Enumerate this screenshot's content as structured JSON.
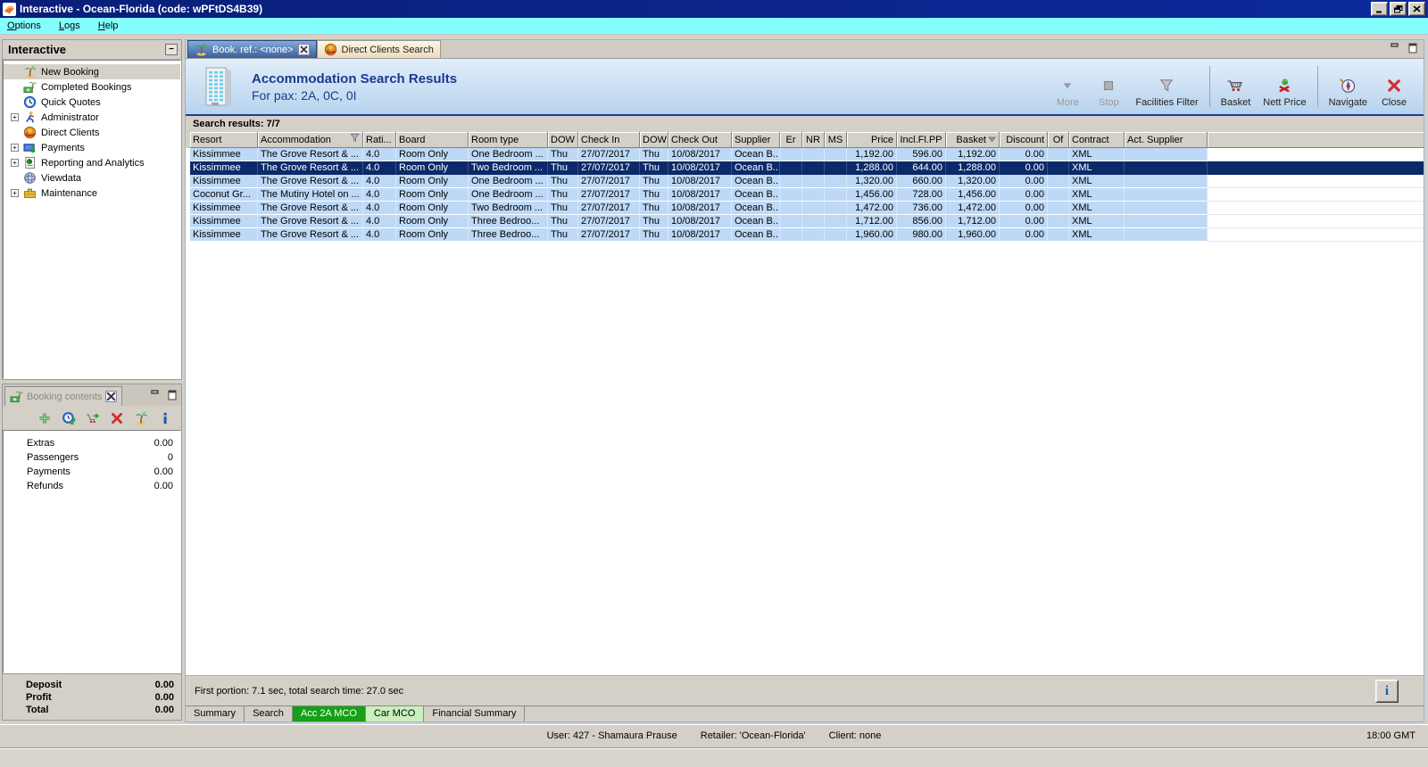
{
  "window": {
    "title": "Interactive - Ocean-Florida (code: wPFtDS4B39)",
    "clock": "18:00 GMT",
    "status": {
      "user": "User: 427 - Shamaura Prause",
      "retailer": "Retailer: 'Ocean-Florida'",
      "client": "Client: none"
    }
  },
  "menu": [
    "Options",
    "Logs",
    "Help"
  ],
  "sidebar": {
    "title": "Interactive",
    "items": [
      {
        "label": "New Booking",
        "icon": "palm-tree-icon",
        "expandable": false,
        "selected": true
      },
      {
        "label": "Completed Bookings",
        "icon": "money-palm-icon",
        "expandable": false,
        "selected": false
      },
      {
        "label": "Quick Quotes",
        "icon": "clock-icon",
        "expandable": false,
        "selected": false
      },
      {
        "label": "Administrator",
        "icon": "runner-icon",
        "expandable": true,
        "selected": false
      },
      {
        "label": "Direct Clients",
        "icon": "globe-red-icon",
        "expandable": false,
        "selected": false
      },
      {
        "label": "Payments",
        "icon": "payments-icon",
        "expandable": true,
        "selected": false
      },
      {
        "label": "Reporting and Analytics",
        "icon": "report-icon",
        "expandable": true,
        "selected": false
      },
      {
        "label": "Viewdata",
        "icon": "globe-blue-icon",
        "expandable": false,
        "selected": false
      },
      {
        "label": "Maintenance",
        "icon": "toolbox-icon",
        "expandable": true,
        "selected": false
      }
    ]
  },
  "doc_tabs": [
    {
      "label": "Book. ref.: <none>",
      "icon": "palm-tree-icon",
      "active": true,
      "closable": true
    },
    {
      "label": "Direct Clients Search",
      "icon": "globe-red-icon",
      "active": false,
      "closable": false
    }
  ],
  "header": {
    "title": "Accommodation Search Results",
    "subtitle": "For pax: 2A, 0C, 0I"
  },
  "toolbar": [
    {
      "label": "More",
      "icon": "more-icon",
      "disabled": true,
      "group": 1
    },
    {
      "label": "Stop",
      "icon": "stop-icon",
      "disabled": true,
      "group": 1
    },
    {
      "label": "Facilities Filter",
      "icon": "funnel-icon",
      "disabled": false,
      "group": 1
    },
    {
      "label": "Basket",
      "icon": "basket-icon",
      "disabled": false,
      "group": 2
    },
    {
      "label": "Nett Price",
      "icon": "nett-price-icon",
      "disabled": false,
      "group": 2
    },
    {
      "label": "Navigate",
      "icon": "navigate-icon",
      "disabled": false,
      "group": 3
    },
    {
      "label": "Close",
      "icon": "close-icon",
      "disabled": false,
      "group": 3
    }
  ],
  "results": {
    "summary": "Search results: 7/7",
    "columns": [
      "Resort",
      "Accommodation",
      "Rati...",
      "Board",
      "Room type",
      "DOW",
      "Check In",
      "DOW",
      "Check Out",
      "Supplier",
      "Er",
      "NR",
      "MS",
      "Price",
      "Incl.Fl.PP",
      "Basket",
      "Discount",
      "Of",
      "Contract",
      "Act. Supplier"
    ],
    "rows": [
      [
        "Kissimmee",
        "The Grove Resort & ...",
        "4.0",
        "Room Only",
        "One Bedroom ...",
        "Thu",
        "27/07/2017",
        "Thu",
        "10/08/2017",
        "Ocean B...",
        "",
        "",
        "",
        "1,192.00",
        "596.00",
        "1,192.00",
        "0.00",
        "",
        "XML",
        ""
      ],
      [
        "Kissimmee",
        "The Grove Resort & ...",
        "4.0",
        "Room Only",
        "Two Bedroom ...",
        "Thu",
        "27/07/2017",
        "Thu",
        "10/08/2017",
        "Ocean B...",
        "",
        "",
        "",
        "1,288.00",
        "644.00",
        "1,288.00",
        "0.00",
        "",
        "XML",
        ""
      ],
      [
        "Kissimmee",
        "The Grove Resort & ...",
        "4.0",
        "Room Only",
        "One Bedroom ...",
        "Thu",
        "27/07/2017",
        "Thu",
        "10/08/2017",
        "Ocean B...",
        "",
        "",
        "",
        "1,320.00",
        "660.00",
        "1,320.00",
        "0.00",
        "",
        "XML",
        ""
      ],
      [
        "Coconut Gr...",
        "The Mutiny Hotel on ...",
        "4.0",
        "Room Only",
        "One Bedroom ...",
        "Thu",
        "27/07/2017",
        "Thu",
        "10/08/2017",
        "Ocean B...",
        "",
        "",
        "",
        "1,456.00",
        "728.00",
        "1,456.00",
        "0.00",
        "",
        "XML",
        ""
      ],
      [
        "Kissimmee",
        "The Grove Resort & ...",
        "4.0",
        "Room Only",
        "Two Bedroom ...",
        "Thu",
        "27/07/2017",
        "Thu",
        "10/08/2017",
        "Ocean B...",
        "",
        "",
        "",
        "1,472.00",
        "736.00",
        "1,472.00",
        "0.00",
        "",
        "XML",
        ""
      ],
      [
        "Kissimmee",
        "The Grove Resort & ...",
        "4.0",
        "Room Only",
        "Three Bedroo...",
        "Thu",
        "27/07/2017",
        "Thu",
        "10/08/2017",
        "Ocean B...",
        "",
        "",
        "",
        "1,712.00",
        "856.00",
        "1,712.00",
        "0.00",
        "",
        "XML",
        ""
      ],
      [
        "Kissimmee",
        "The Grove Resort & ...",
        "4.0",
        "Room Only",
        "Three Bedroo...",
        "Thu",
        "27/07/2017",
        "Thu",
        "10/08/2017",
        "Ocean B...",
        "",
        "",
        "",
        "1,960.00",
        "980.00",
        "1,960.00",
        "0.00",
        "",
        "XML",
        ""
      ]
    ],
    "selected_row": 1,
    "status": "First portion: 7.1 sec, total search time: 27.0 sec"
  },
  "bottom_tabs": [
    {
      "label": "Summary",
      "style": "plain"
    },
    {
      "label": "Search",
      "style": "plain"
    },
    {
      "label": "Acc 2A MCO",
      "style": "green"
    },
    {
      "label": "Car MCO",
      "style": "lightgreen"
    },
    {
      "label": "Financial Summary",
      "style": "plain"
    }
  ],
  "booking_contents": {
    "title": "Booking contents",
    "rows": [
      {
        "label": "Extras",
        "value": "0.00"
      },
      {
        "label": "Passengers",
        "value": "0"
      },
      {
        "label": "Payments",
        "value": "0.00"
      },
      {
        "label": "Refunds",
        "value": "0.00"
      }
    ],
    "totals": [
      {
        "label": "Deposit",
        "value": "0.00"
      },
      {
        "label": "Profit",
        "value": "0.00"
      },
      {
        "label": "Total",
        "value": "0.00"
      }
    ]
  },
  "colors": {
    "title_navy": "#0a1e78",
    "menu_cyan": "#84ffff",
    "selection_navy": "#0c2a69",
    "row_blue": "#bdd9f6",
    "tab_green": "#16a016",
    "tab_light_green": "#c9f0bc",
    "header_text_navy": "#1a3a8c"
  }
}
